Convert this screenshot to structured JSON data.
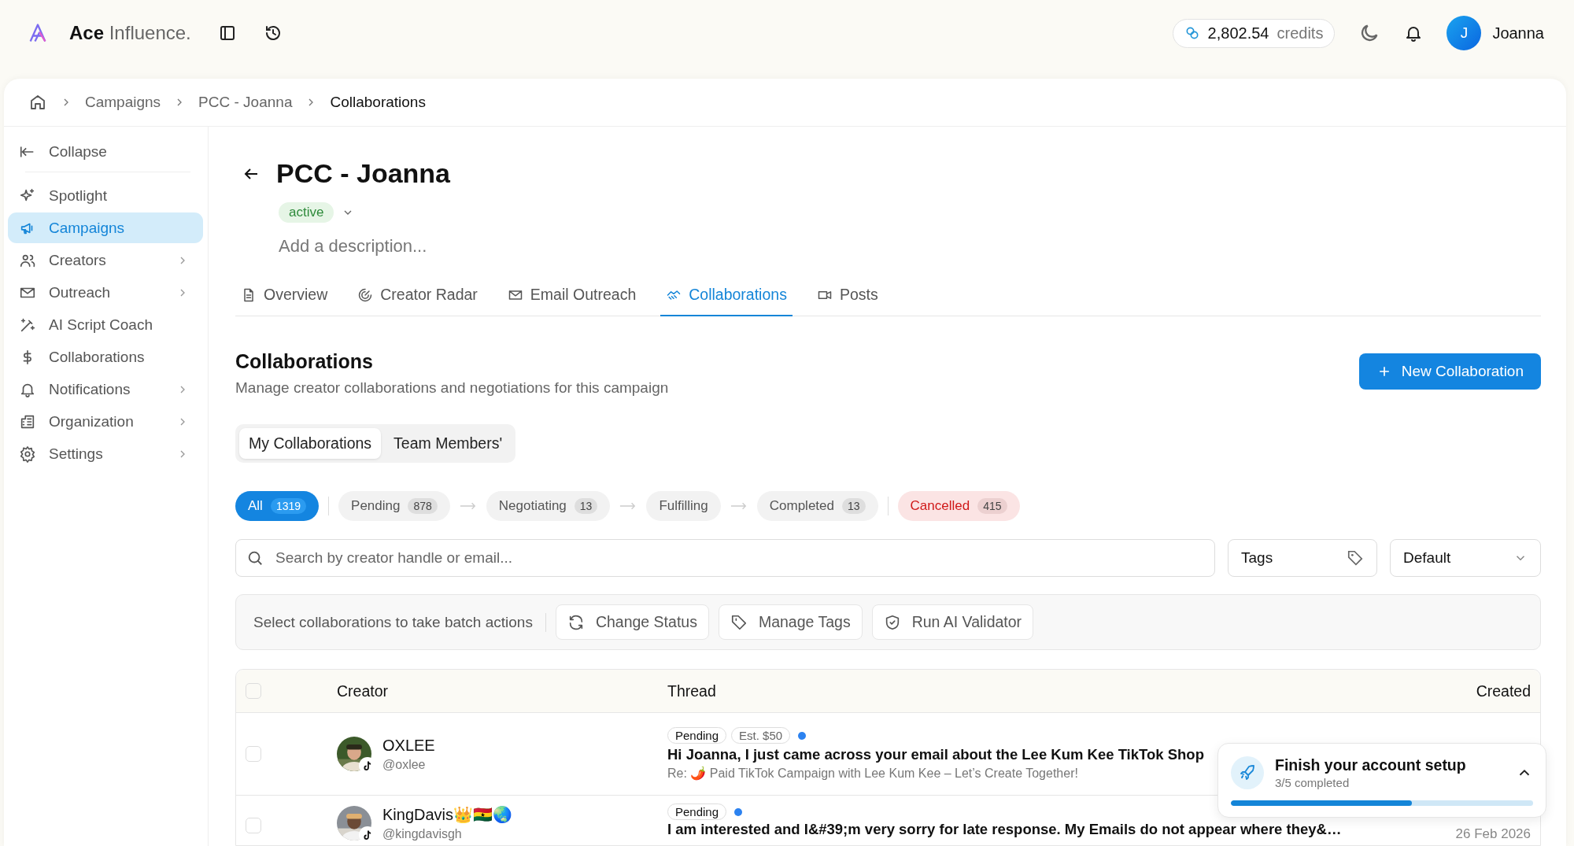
{
  "brand": {
    "name": "Ace",
    "suffix": "Influence."
  },
  "topbar": {
    "credits_value": "2,802.54",
    "credits_label": "credits",
    "avatar_initial": "J",
    "user": "Joanna"
  },
  "breadcrumb": [
    "Campaigns",
    "PCC - Joanna",
    "Collaborations"
  ],
  "sidebar": {
    "collapse": "Collapse",
    "items": [
      {
        "label": "Spotlight",
        "selected": false,
        "expandable": false
      },
      {
        "label": "Campaigns",
        "selected": true,
        "expandable": false
      },
      {
        "label": "Creators",
        "selected": false,
        "expandable": true
      },
      {
        "label": "Outreach",
        "selected": false,
        "expandable": true
      },
      {
        "label": "AI Script Coach",
        "selected": false,
        "expandable": false
      },
      {
        "label": "Collaborations",
        "selected": false,
        "expandable": false
      },
      {
        "label": "Notifications",
        "selected": false,
        "expandable": true
      },
      {
        "label": "Organization",
        "selected": false,
        "expandable": true
      },
      {
        "label": "Settings",
        "selected": false,
        "expandable": true
      }
    ]
  },
  "campaign": {
    "title": "PCC - Joanna",
    "status": "active",
    "description_placeholder": "Add a description..."
  },
  "tabs": [
    {
      "label": "Overview",
      "selected": false
    },
    {
      "label": "Creator Radar",
      "selected": false
    },
    {
      "label": "Email Outreach",
      "selected": false
    },
    {
      "label": "Collaborations",
      "selected": true
    },
    {
      "label": "Posts",
      "selected": false
    }
  ],
  "section": {
    "title": "Collaborations",
    "subtitle": "Manage creator collaborations and negotiations for this campaign",
    "new_button": "New Collaboration"
  },
  "scope_tabs": [
    {
      "label": "My Collaborations",
      "selected": true
    },
    {
      "label": "Team Members'",
      "selected": false
    }
  ],
  "filters": [
    {
      "label": "All",
      "count": "1319",
      "selected": true,
      "kind": "normal"
    },
    {
      "label": "Pending",
      "count": "878",
      "selected": false,
      "kind": "normal",
      "divider_before": true
    },
    {
      "label": "Negotiating",
      "count": "13",
      "selected": false,
      "kind": "normal",
      "arrow_before": true
    },
    {
      "label": "Fulfilling",
      "selected": false,
      "kind": "normal",
      "arrow_before": true
    },
    {
      "label": "Completed",
      "count": "13",
      "selected": false,
      "kind": "normal",
      "arrow_before": true
    },
    {
      "label": "Cancelled",
      "count": "415",
      "selected": false,
      "kind": "negative",
      "divider_before": true
    }
  ],
  "search": {
    "placeholder": "Search by creator handle or email..."
  },
  "tags_filter": "Tags",
  "sort": "Default",
  "batch": {
    "hint": "Select collaborations to take batch actions",
    "actions": [
      "Change Status",
      "Manage Tags",
      "Run AI Validator"
    ]
  },
  "table": {
    "columns": [
      "Creator",
      "Thread",
      "Created"
    ],
    "all_checked": false,
    "rows": [
      {
        "checked": false,
        "name": "OXLEE",
        "handle": "@oxlee",
        "tags": [
          "Pending",
          "Est. $50"
        ],
        "unread": true,
        "title": "Hi Joanna, I just came across your email about the Lee Kum Kee TikTok Shop",
        "subject": "Re: 🌶️ Paid TikTok Campaign with Lee Kum Kee – Let’s Create Together!"
      },
      {
        "checked": false,
        "name": "KingDavis👑🇬🇭🌏",
        "handle": "@kingdavisgh",
        "tags": [
          "Pending"
        ],
        "unread": true,
        "title": "I am interested and I&#39;m very sorry for late response. My Emails do not appear where they&…",
        "created": "26 Feb 2026"
      }
    ]
  },
  "setup": {
    "title": "Finish your account setup",
    "progress": "3/5 completed",
    "level": 0.6
  }
}
